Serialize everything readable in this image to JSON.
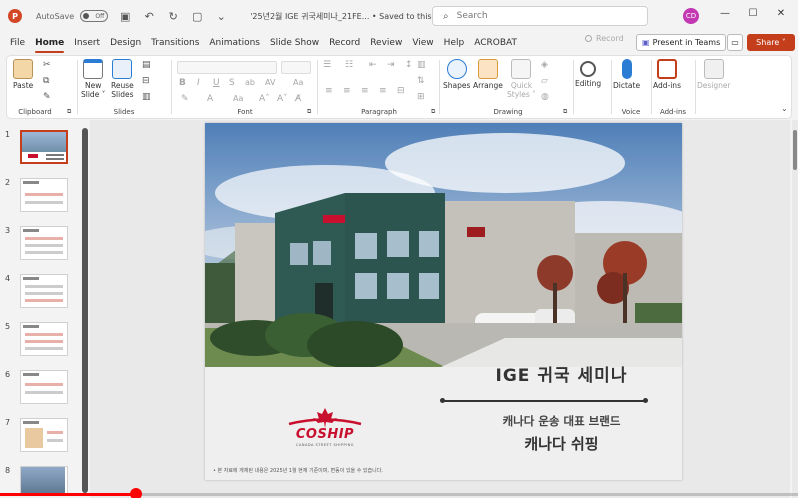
{
  "titlebar": {
    "app_logo": "P",
    "autosave_label": "AutoSave",
    "autosave_state": "Off",
    "doc_title": "'25년2월 IGE 귀국세미나_21FE...  •  Saved to this PC ˅",
    "search_placeholder": "Search",
    "user_initials": "CD"
  },
  "menu": {
    "tabs": [
      "File",
      "Home",
      "Insert",
      "Design",
      "Transitions",
      "Animations",
      "Slide Show",
      "Record",
      "Review",
      "View",
      "Help",
      "ACROBAT"
    ],
    "active": "Home",
    "record_label": "Record",
    "present_label": "Present in Teams",
    "share_label": "Share ˅"
  },
  "ribbon": {
    "clipboard": {
      "label": "Clipboard",
      "paste": "Paste"
    },
    "slides": {
      "label": "Slides",
      "new_slide": "New\nSlide ˅",
      "reuse_slides": "Reuse\nSlides"
    },
    "font": {
      "label": "Font"
    },
    "paragraph": {
      "label": "Paragraph"
    },
    "drawing": {
      "label": "Drawing",
      "shapes": "Shapes",
      "arrange": "Arrange",
      "quick_styles": "Quick\nStyles ˅"
    },
    "editing": {
      "label": "",
      "editing": "Editing"
    },
    "voice": {
      "label": "Voice",
      "dictate": "Dictate"
    },
    "addins": {
      "label": "Add-ins",
      "addins": "Add-ins",
      "designer": "Designer"
    },
    "icons": {
      "cut": "scissors-icon",
      "copy": "copy-icon",
      "format_painter": "brush-icon",
      "bold": "B",
      "italic": "I",
      "underline": "U",
      "strike": "S",
      "shadow": "ab",
      "spacing": "AV",
      "grow": "A^",
      "shrink": "Aˇ",
      "clear": "A",
      "case": "Aa"
    }
  },
  "slides_pane": {
    "numbers": [
      "1",
      "2",
      "3",
      "4",
      "5",
      "6",
      "7",
      "8"
    ],
    "selected": "1"
  },
  "slide": {
    "title": "IGE 귀국 세미나",
    "subtitle": "캐나다 운송 대표 브랜드",
    "company_name": "캐나다 쉬핑",
    "logo_text": "COSHIP",
    "logo_tagline": "CANADA STREET SHIPPING",
    "footnote": "• 본 자료에 게재된 내용은 2025년 1월 현재 기준이며, 변동이 있을 수 있습니다."
  },
  "video": {
    "progress": 0.17,
    "accent": "#ff0000"
  },
  "colors": {
    "accent": "#c43e1c",
    "logo_red": "#c8102e"
  }
}
